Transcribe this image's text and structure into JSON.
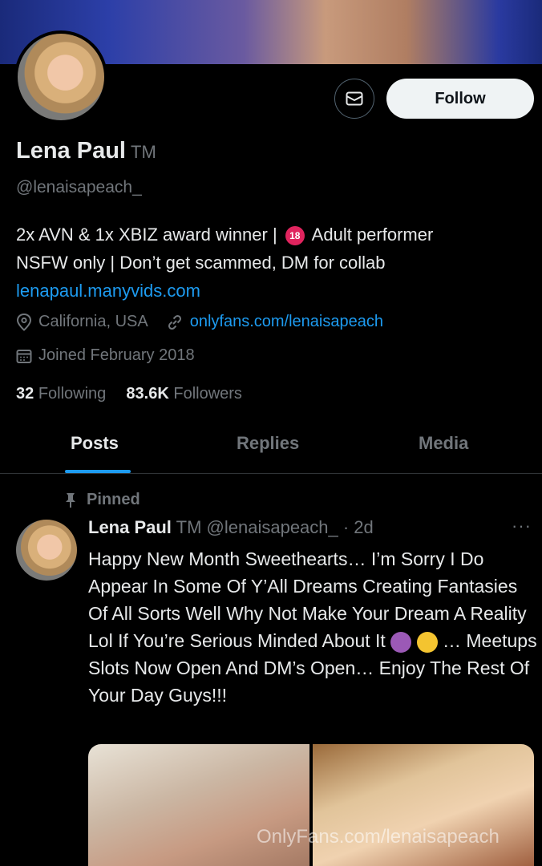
{
  "profile": {
    "name": "Lena Paul",
    "tm": "TM",
    "handle": "@lenaisapeach_",
    "follow_label": "Follow",
    "bio_line1_a": "2x AVN & 1x XBIZ award winner | ",
    "bio_badge": "18",
    "bio_line1_b": " Adult performer",
    "bio_line2": "NSFW only | Don’t get scammed, DM for collab",
    "bio_link": "lenapaul.manyvids.com",
    "location": "California, USA",
    "website": "onlyfans.com/lenaisapeach",
    "joined": "Joined February 2018",
    "following_count": "32",
    "following_label": "Following",
    "followers_count": "83.6K",
    "followers_label": "Followers"
  },
  "tabs": [
    "Posts",
    "Replies",
    "Media"
  ],
  "post": {
    "pinned_label": "Pinned",
    "author_name": "Lena Paul",
    "author_tm": "TM",
    "author_handle_time": "@lenaisapeach_ · 2d",
    "more": "···",
    "text_a": "Happy New Month Sweethearts… I’m Sorry I Do Appear In Some Of Y’All Dreams Creating Fantasies Of All Sorts Well Why Not Make Your Dream A Reality Lol If You’re Serious Minded About It ",
    "text_b": " … Meetups Slots Now Open And DM’s Open… Enjoy The Rest Of Your Day Guys!!!",
    "watermark": "OnlyFans.com/lenaisapeach"
  },
  "colors": {
    "accent": "#1d9bf0",
    "bg": "#000000",
    "muted": "#71767b"
  },
  "icons": [
    "mail-icon",
    "location-pin-icon",
    "link-icon",
    "calendar-icon",
    "pin-icon",
    "more-icon"
  ]
}
